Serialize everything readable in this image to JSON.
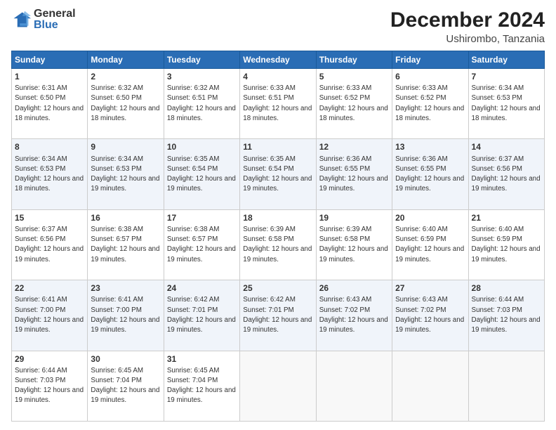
{
  "logo": {
    "general": "General",
    "blue": "Blue"
  },
  "header": {
    "title": "December 2024",
    "subtitle": "Ushirombo, Tanzania"
  },
  "weekdays": [
    "Sunday",
    "Monday",
    "Tuesday",
    "Wednesday",
    "Thursday",
    "Friday",
    "Saturday"
  ],
  "weeks": [
    [
      {
        "day": "1",
        "sunrise": "6:31 AM",
        "sunset": "6:50 PM",
        "daylight": "12 hours and 18 minutes."
      },
      {
        "day": "2",
        "sunrise": "6:32 AM",
        "sunset": "6:50 PM",
        "daylight": "12 hours and 18 minutes."
      },
      {
        "day": "3",
        "sunrise": "6:32 AM",
        "sunset": "6:51 PM",
        "daylight": "12 hours and 18 minutes."
      },
      {
        "day": "4",
        "sunrise": "6:33 AM",
        "sunset": "6:51 PM",
        "daylight": "12 hours and 18 minutes."
      },
      {
        "day": "5",
        "sunrise": "6:33 AM",
        "sunset": "6:52 PM",
        "daylight": "12 hours and 18 minutes."
      },
      {
        "day": "6",
        "sunrise": "6:33 AM",
        "sunset": "6:52 PM",
        "daylight": "12 hours and 18 minutes."
      },
      {
        "day": "7",
        "sunrise": "6:34 AM",
        "sunset": "6:53 PM",
        "daylight": "12 hours and 18 minutes."
      }
    ],
    [
      {
        "day": "8",
        "sunrise": "6:34 AM",
        "sunset": "6:53 PM",
        "daylight": "12 hours and 18 minutes."
      },
      {
        "day": "9",
        "sunrise": "6:34 AM",
        "sunset": "6:53 PM",
        "daylight": "12 hours and 19 minutes."
      },
      {
        "day": "10",
        "sunrise": "6:35 AM",
        "sunset": "6:54 PM",
        "daylight": "12 hours and 19 minutes."
      },
      {
        "day": "11",
        "sunrise": "6:35 AM",
        "sunset": "6:54 PM",
        "daylight": "12 hours and 19 minutes."
      },
      {
        "day": "12",
        "sunrise": "6:36 AM",
        "sunset": "6:55 PM",
        "daylight": "12 hours and 19 minutes."
      },
      {
        "day": "13",
        "sunrise": "6:36 AM",
        "sunset": "6:55 PM",
        "daylight": "12 hours and 19 minutes."
      },
      {
        "day": "14",
        "sunrise": "6:37 AM",
        "sunset": "6:56 PM",
        "daylight": "12 hours and 19 minutes."
      }
    ],
    [
      {
        "day": "15",
        "sunrise": "6:37 AM",
        "sunset": "6:56 PM",
        "daylight": "12 hours and 19 minutes."
      },
      {
        "day": "16",
        "sunrise": "6:38 AM",
        "sunset": "6:57 PM",
        "daylight": "12 hours and 19 minutes."
      },
      {
        "day": "17",
        "sunrise": "6:38 AM",
        "sunset": "6:57 PM",
        "daylight": "12 hours and 19 minutes."
      },
      {
        "day": "18",
        "sunrise": "6:39 AM",
        "sunset": "6:58 PM",
        "daylight": "12 hours and 19 minutes."
      },
      {
        "day": "19",
        "sunrise": "6:39 AM",
        "sunset": "6:58 PM",
        "daylight": "12 hours and 19 minutes."
      },
      {
        "day": "20",
        "sunrise": "6:40 AM",
        "sunset": "6:59 PM",
        "daylight": "12 hours and 19 minutes."
      },
      {
        "day": "21",
        "sunrise": "6:40 AM",
        "sunset": "6:59 PM",
        "daylight": "12 hours and 19 minutes."
      }
    ],
    [
      {
        "day": "22",
        "sunrise": "6:41 AM",
        "sunset": "7:00 PM",
        "daylight": "12 hours and 19 minutes."
      },
      {
        "day": "23",
        "sunrise": "6:41 AM",
        "sunset": "7:00 PM",
        "daylight": "12 hours and 19 minutes."
      },
      {
        "day": "24",
        "sunrise": "6:42 AM",
        "sunset": "7:01 PM",
        "daylight": "12 hours and 19 minutes."
      },
      {
        "day": "25",
        "sunrise": "6:42 AM",
        "sunset": "7:01 PM",
        "daylight": "12 hours and 19 minutes."
      },
      {
        "day": "26",
        "sunrise": "6:43 AM",
        "sunset": "7:02 PM",
        "daylight": "12 hours and 19 minutes."
      },
      {
        "day": "27",
        "sunrise": "6:43 AM",
        "sunset": "7:02 PM",
        "daylight": "12 hours and 19 minutes."
      },
      {
        "day": "28",
        "sunrise": "6:44 AM",
        "sunset": "7:03 PM",
        "daylight": "12 hours and 19 minutes."
      }
    ],
    [
      {
        "day": "29",
        "sunrise": "6:44 AM",
        "sunset": "7:03 PM",
        "daylight": "12 hours and 19 minutes."
      },
      {
        "day": "30",
        "sunrise": "6:45 AM",
        "sunset": "7:04 PM",
        "daylight": "12 hours and 19 minutes."
      },
      {
        "day": "31",
        "sunrise": "6:45 AM",
        "sunset": "7:04 PM",
        "daylight": "12 hours and 19 minutes."
      },
      null,
      null,
      null,
      null
    ]
  ]
}
